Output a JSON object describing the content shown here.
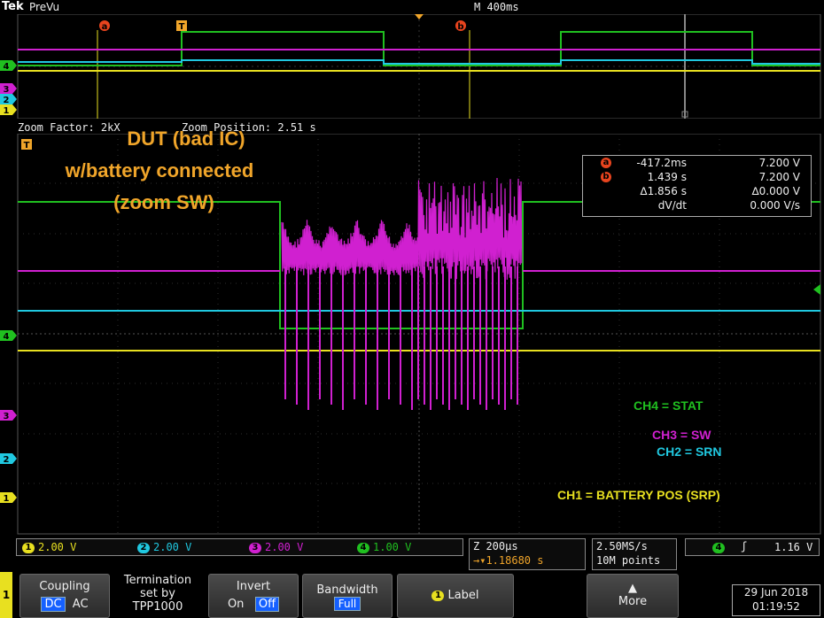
{
  "header": {
    "brand": "Tek",
    "mode": "PreVu",
    "time_scale": "M 400ms"
  },
  "zoom": {
    "factor_label": "Zoom Factor: 2kX",
    "position_label": "Zoom Position: 2.51 s"
  },
  "markers": {
    "cursor_a": "a",
    "cursor_b": "b",
    "trigger": "T",
    "ch4": "4",
    "ch3": "3",
    "ch2": "2",
    "ch1": "1"
  },
  "annotation": {
    "line1": "DUT (bad IC)",
    "line2": "w/battery connected",
    "line3": "(zoom SW)"
  },
  "cursor_readout": {
    "a_time": "-417.2ms",
    "a_volt": "7.200 V",
    "b_time": "1.439 s",
    "b_volt": "7.200 V",
    "delta_time": "∆1.856 s",
    "delta_volt": "∆0.000 V",
    "dvdt_label": "dV/dt",
    "dvdt_value": "0.000 V/s"
  },
  "channel_labels": {
    "ch4": "CH4 = STAT",
    "ch3": "CH3 = SW",
    "ch2": "CH2 = SRN",
    "ch1": "CH1 = BATTERY POS (SRP)"
  },
  "status": {
    "ch1_num": "1",
    "ch1_scale": "2.00 V",
    "ch2_num": "2",
    "ch2_scale": "2.00 V",
    "ch3_num": "3",
    "ch3_scale": "2.00 V",
    "ch4_num": "4",
    "ch4_scale": "1.00 V",
    "zoom_time": "Z 200µs",
    "trigger_pos": "→▾1.18680 s",
    "sample_rate": "2.50MS/s",
    "record_length": "10M points",
    "trig_ch": "4",
    "trig_level": "1.16 V"
  },
  "menu": {
    "channel": "1",
    "coupling": "Coupling",
    "coupling_dc": "DC",
    "coupling_ac": "AC",
    "termination_l1": "Termination",
    "termination_l2": "set by",
    "termination_l3": "TPP1000",
    "invert": "Invert",
    "invert_on": "On",
    "invert_off": "Off",
    "bandwidth": "Bandwidth",
    "bandwidth_val": "Full",
    "label_num": "1",
    "label": "Label",
    "more": "More",
    "date": "29 Jun 2018",
    "time": "01:19:52"
  },
  "colors": {
    "ch1": "#e8e020",
    "ch2": "#20c8e0",
    "ch3": "#d020d0",
    "ch4": "#20c020",
    "accent": "#f0a52a"
  }
}
